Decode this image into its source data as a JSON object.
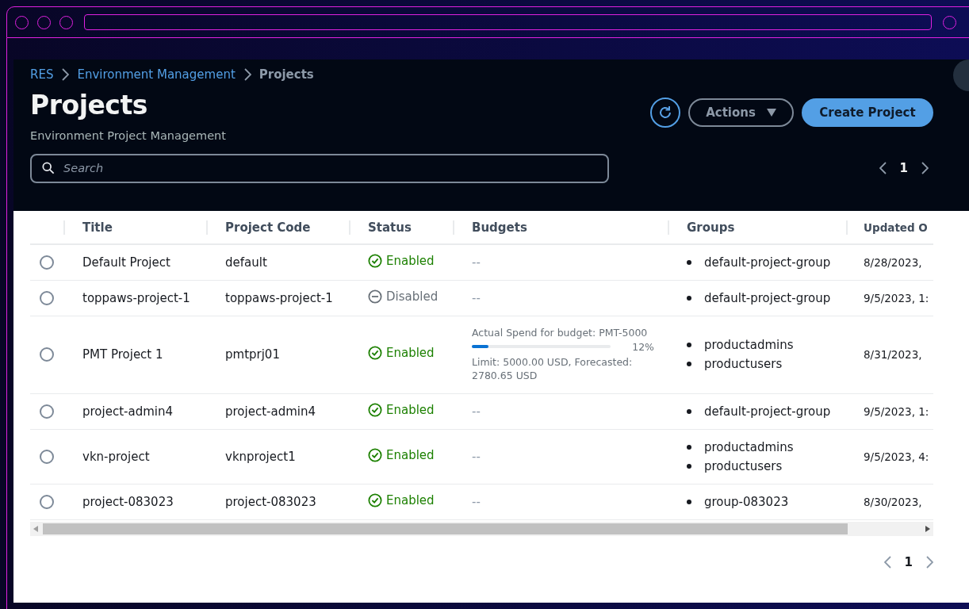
{
  "breadcrumbs": [
    {
      "label": "RES",
      "kind": "link"
    },
    {
      "label": "Environment Management",
      "kind": "link"
    },
    {
      "label": "Projects",
      "kind": "current"
    }
  ],
  "header": {
    "title": "Projects",
    "subtitle": "Environment Project Management",
    "actions_label": "Actions",
    "create_label": "Create Project"
  },
  "search": {
    "placeholder": "Search"
  },
  "pagination_top": {
    "page": "1"
  },
  "table": {
    "columns": [
      "Title",
      "Project Code",
      "Status",
      "Budgets",
      "Groups",
      "Updated O"
    ],
    "rows": [
      {
        "selected": false,
        "title": "Default Project",
        "code": "default",
        "status": {
          "kind": "enabled",
          "label": "Enabled"
        },
        "budget": {
          "kind": "empty",
          "text": "--"
        },
        "groups": [
          "default-project-group"
        ],
        "updated": "8/28/2023,"
      },
      {
        "selected": false,
        "title": "toppaws-project-1",
        "code": "toppaws-project-1",
        "status": {
          "kind": "disabled",
          "label": "Disabled"
        },
        "budget": {
          "kind": "empty",
          "text": "--"
        },
        "groups": [
          "default-project-group"
        ],
        "updated": "9/5/2023, 1:"
      },
      {
        "selected": false,
        "title": "PMT Project 1",
        "code": "pmtprj01",
        "status": {
          "kind": "enabled",
          "label": "Enabled"
        },
        "budget": {
          "kind": "spend",
          "caption": "Actual Spend for budget: PMT-5000",
          "level": 0.12,
          "percent": "12%",
          "limit": "Limit: 5000.00 USD, Forecasted: 2780.65 USD"
        },
        "groups": [
          "productadmins",
          "productusers"
        ],
        "updated": "8/31/2023,"
      },
      {
        "selected": false,
        "title": "project-admin4",
        "code": "project-admin4",
        "status": {
          "kind": "enabled",
          "label": "Enabled"
        },
        "budget": {
          "kind": "empty",
          "text": "--"
        },
        "groups": [
          "default-project-group"
        ],
        "updated": "9/5/2023, 1:"
      },
      {
        "selected": false,
        "title": "vkn-project",
        "code": "vknproject1",
        "status": {
          "kind": "enabled",
          "label": "Enabled"
        },
        "budget": {
          "kind": "empty",
          "text": "--"
        },
        "groups": [
          "productadmins",
          "productusers"
        ],
        "updated": "9/5/2023, 4:"
      },
      {
        "selected": false,
        "title": "project-083023",
        "code": "project-083023",
        "status": {
          "kind": "enabled",
          "label": "Enabled"
        },
        "budget": {
          "kind": "empty",
          "text": "--"
        },
        "groups": [
          "group-083023"
        ],
        "updated": "8/30/2023,"
      }
    ]
  },
  "pagination_bottom": {
    "page": "1"
  }
}
